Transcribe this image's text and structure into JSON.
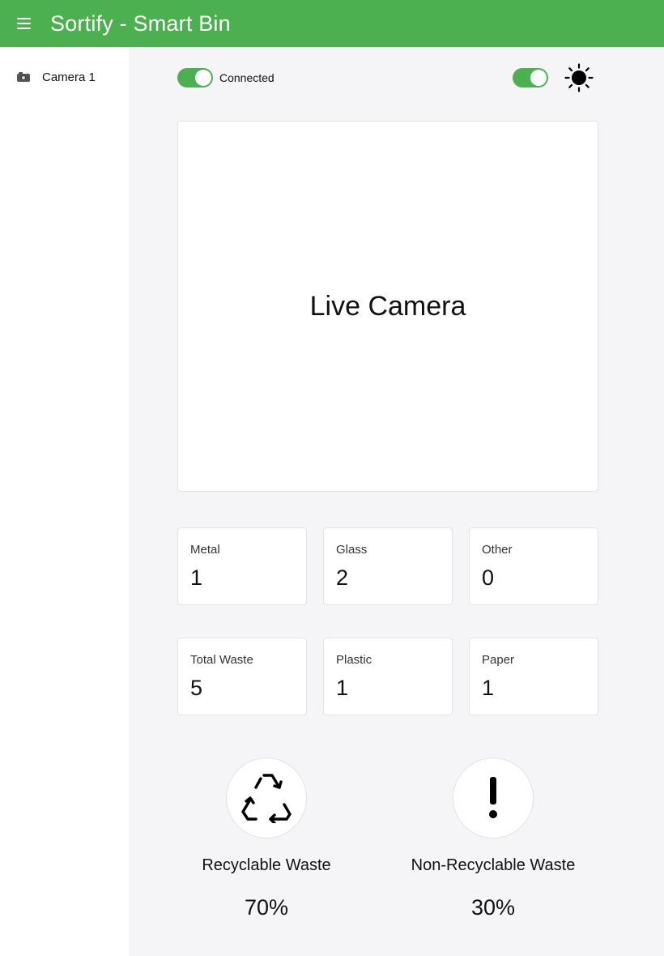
{
  "app": {
    "title": "Sortify - Smart Bin"
  },
  "sidebar": {
    "items": [
      {
        "label": "Camera 1",
        "icon": "camera-icon"
      }
    ]
  },
  "toolbar": {
    "connection_label": "Connected",
    "connection_on": true,
    "theme_on": true,
    "theme_icon": "sun-icon"
  },
  "camera": {
    "placeholder": "Live Camera"
  },
  "stats": [
    {
      "label": "Metal",
      "value": "1"
    },
    {
      "label": "Glass",
      "value": "2"
    },
    {
      "label": "Other",
      "value": "0"
    },
    {
      "label": "Total Waste",
      "value": "5"
    },
    {
      "label": "Plastic",
      "value": "1"
    },
    {
      "label": "Paper",
      "value": "1"
    }
  ],
  "summary": {
    "recyclable": {
      "label": "Recyclable Waste",
      "percent": "70%",
      "icon": "recycle-icon"
    },
    "non_recyclable": {
      "label": "Non-Recyclable Waste",
      "percent": "30%",
      "icon": "exclamation-icon"
    }
  },
  "colors": {
    "brand": "#4caf50",
    "background": "#f5f5f7",
    "card": "#ffffff"
  }
}
